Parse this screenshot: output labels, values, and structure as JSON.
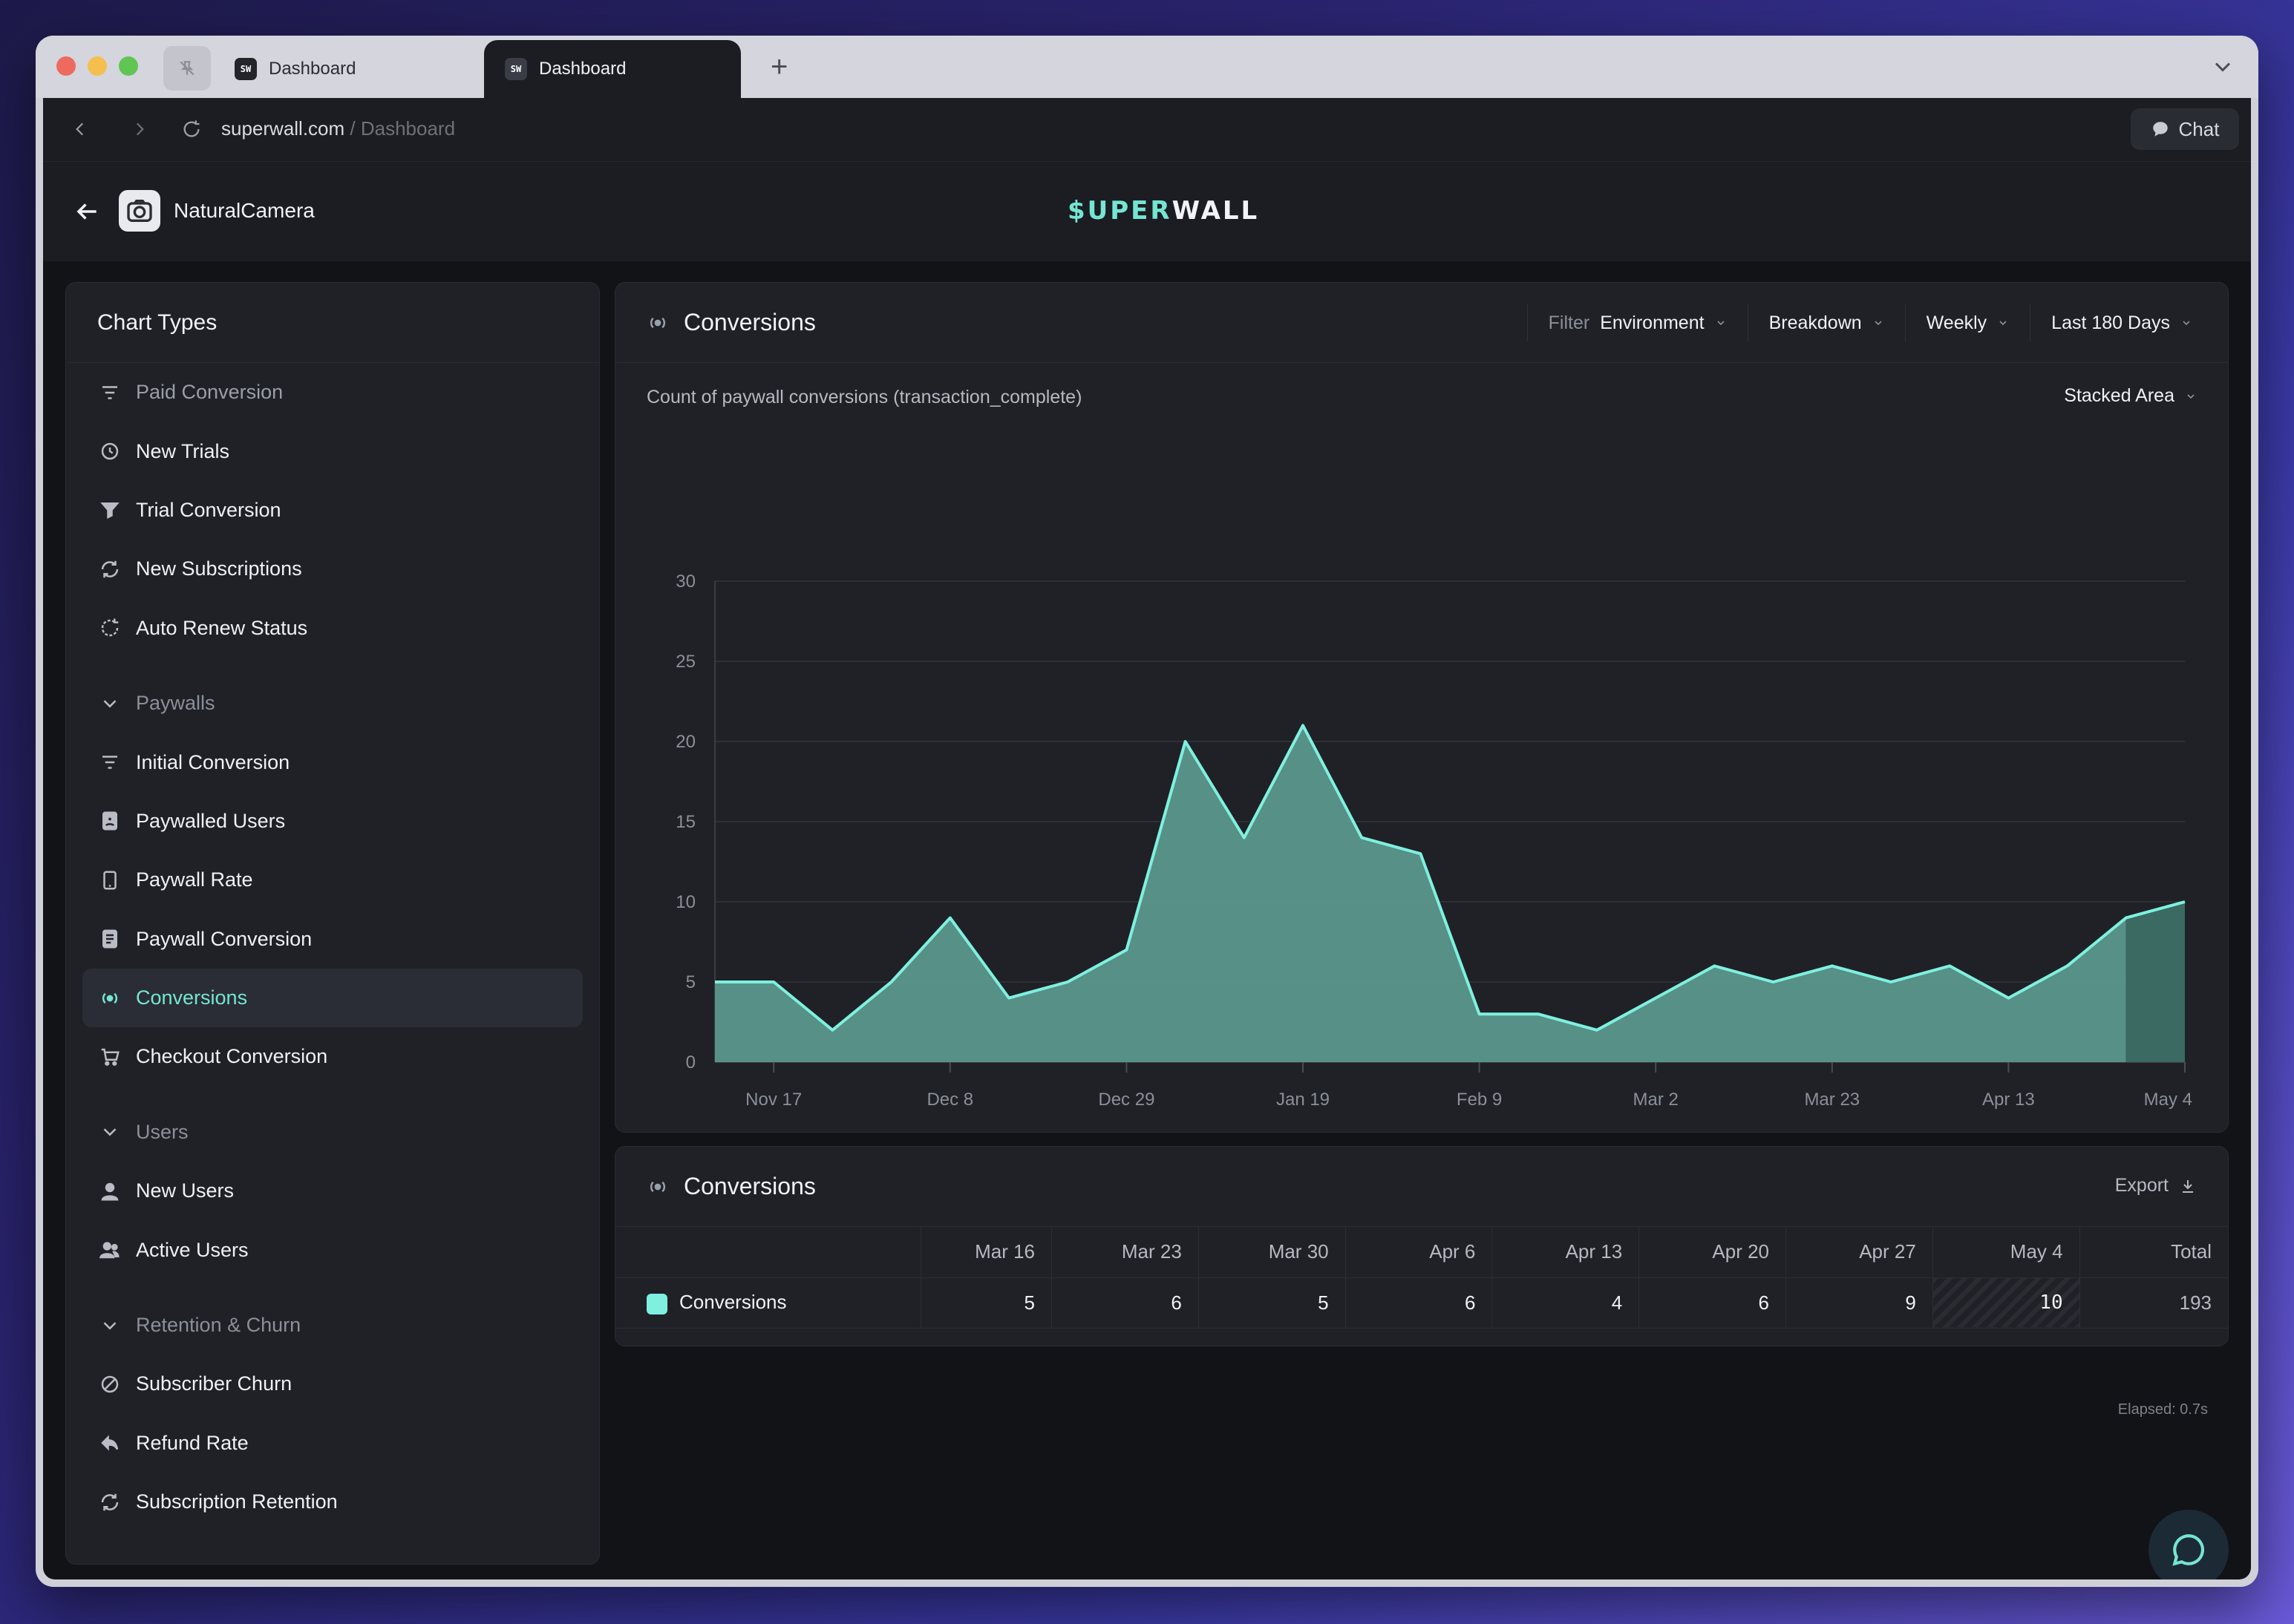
{
  "browser": {
    "tabs": [
      {
        "label": "Dashboard",
        "favicon": "SW"
      },
      {
        "label": "Dashboard",
        "favicon": "SW"
      }
    ],
    "url_host": "superwall.com",
    "url_path": "/ Dashboard",
    "chat_label": "Chat"
  },
  "header": {
    "app_name": "NaturalCamera",
    "brand_prefix": "$UPER",
    "brand_suffix": "WALL"
  },
  "sidebar": {
    "title": "Chart Types",
    "items": [
      {
        "label": "Paid Conversion",
        "icon": "filter-lines-icon",
        "kind": "dim"
      },
      {
        "label": "New Trials",
        "icon": "timer-icon",
        "kind": "item"
      },
      {
        "label": "Trial Conversion",
        "icon": "funnel-icon",
        "kind": "item"
      },
      {
        "label": "New Subscriptions",
        "icon": "refresh-icon",
        "kind": "item"
      },
      {
        "label": "Auto Renew Status",
        "icon": "dashed-refresh-icon",
        "kind": "item"
      },
      {
        "label": "Paywalls",
        "icon": "chevron-down-icon",
        "kind": "section"
      },
      {
        "label": "Initial Conversion",
        "icon": "filter-lines-icon",
        "kind": "item"
      },
      {
        "label": "Paywalled Users",
        "icon": "user-badge-icon",
        "kind": "item"
      },
      {
        "label": "Paywall Rate",
        "icon": "tablet-icon",
        "kind": "item"
      },
      {
        "label": "Paywall Conversion",
        "icon": "document-icon",
        "kind": "item"
      },
      {
        "label": "Conversions",
        "icon": "broadcast-icon",
        "kind": "active"
      },
      {
        "label": "Checkout Conversion",
        "icon": "cart-icon",
        "kind": "item"
      },
      {
        "label": "Users",
        "icon": "chevron-down-icon",
        "kind": "section"
      },
      {
        "label": "New Users",
        "icon": "user-icon",
        "kind": "item"
      },
      {
        "label": "Active Users",
        "icon": "users-icon",
        "kind": "item"
      },
      {
        "label": "Retention & Churn",
        "icon": "chevron-down-icon",
        "kind": "section"
      },
      {
        "label": "Subscriber Churn",
        "icon": "slash-circle-icon",
        "kind": "item"
      },
      {
        "label": "Refund Rate",
        "icon": "reply-icon",
        "kind": "item"
      },
      {
        "label": "Subscription Retention",
        "icon": "refresh-icon",
        "kind": "item"
      }
    ]
  },
  "chart_panel": {
    "title": "Conversions",
    "filter_label": "Filter",
    "filter_value": "Environment",
    "breakdown": "Breakdown",
    "interval": "Weekly",
    "range": "Last 180 Days",
    "subtitle": "Count of paywall conversions (transaction_complete)",
    "chart_type": "Stacked Area"
  },
  "chart_data": {
    "type": "area",
    "series": [
      {
        "values": [
          5,
          5,
          2,
          5,
          9,
          4,
          5,
          7,
          20,
          14,
          21,
          14,
          13,
          3,
          3,
          2,
          4,
          6,
          5,
          6,
          5,
          6,
          4,
          6,
          9,
          10
        ]
      }
    ],
    "x_tick_labels": [
      "Nov 17",
      "Dec 8",
      "Dec 29",
      "Jan 19",
      "Feb 9",
      "Mar 2",
      "Mar 23",
      "Apr 13",
      "May 4"
    ],
    "y_ticks": [
      0,
      5,
      10,
      15,
      20,
      25,
      30
    ],
    "ylim": [
      0,
      30
    ],
    "grid": true,
    "fill_color": "#5b9a8f",
    "line_color": "#7ff0df",
    "partial_fill_color": "#3a6a62"
  },
  "table": {
    "title": "Conversions",
    "export_label": "Export",
    "columns": [
      "Mar 16",
      "Mar 23",
      "Mar 30",
      "Apr 6",
      "Apr 13",
      "Apr 20",
      "Apr 27",
      "May 4",
      "Total"
    ],
    "rows": [
      {
        "label": "Conversions",
        "color": "#7ff0df",
        "values": [
          "5",
          "6",
          "5",
          "6",
          "4",
          "6",
          "9",
          "10",
          "193"
        ]
      }
    ]
  },
  "footer": {
    "elapsed": "Elapsed: 0.7s"
  }
}
